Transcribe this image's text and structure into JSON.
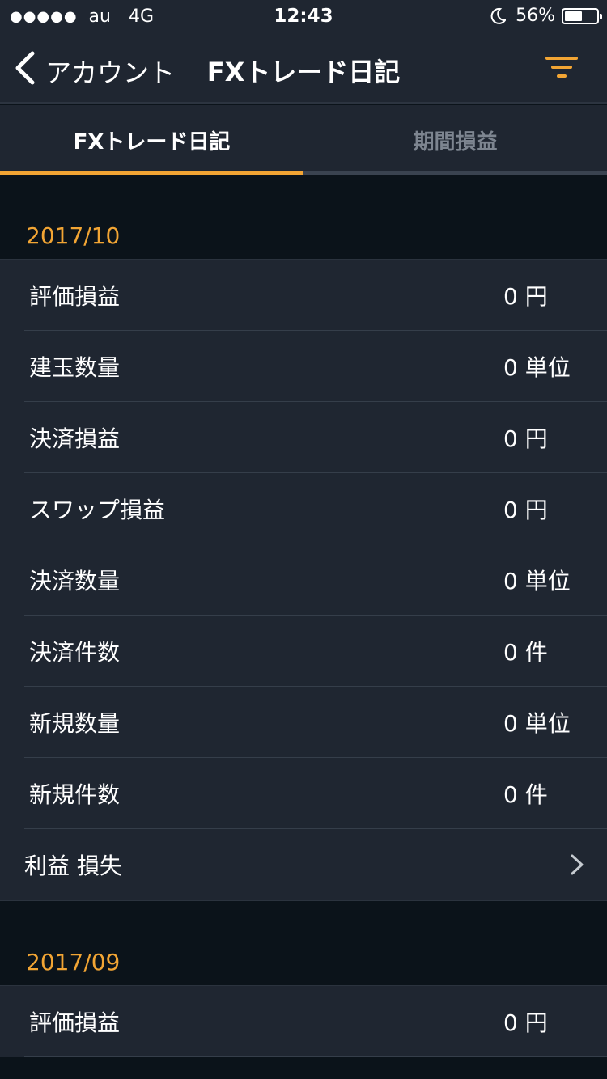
{
  "status_bar": {
    "signal": "●●●●●",
    "carrier": "au",
    "network": "4G",
    "time": "12:43",
    "battery_percent": "56%",
    "battery_level": 0.56
  },
  "nav": {
    "back_label": "アカウント",
    "title": "FXトレード日記",
    "accent_color": "#f2a534"
  },
  "tabs": [
    {
      "label": "FXトレード日記",
      "active": true
    },
    {
      "label": "期間損益",
      "active": false
    }
  ],
  "sections": [
    {
      "month": "2017/10",
      "rows": [
        {
          "label": "評価損益",
          "value": "0 円"
        },
        {
          "label": "建玉数量",
          "value": "0 単位"
        },
        {
          "label": "決済損益",
          "value": "0 円"
        },
        {
          "label": "スワップ損益",
          "value": "0 円"
        },
        {
          "label": "決済数量",
          "value": "0 単位"
        },
        {
          "label": "決済件数",
          "value": "0 件"
        },
        {
          "label": "新規数量",
          "value": "0 単位"
        },
        {
          "label": "新規件数",
          "value": "0 件"
        }
      ],
      "link_label": "利益 損失"
    },
    {
      "month": "2017/09",
      "rows": [
        {
          "label": "評価損益",
          "value": "0 円"
        }
      ]
    }
  ]
}
